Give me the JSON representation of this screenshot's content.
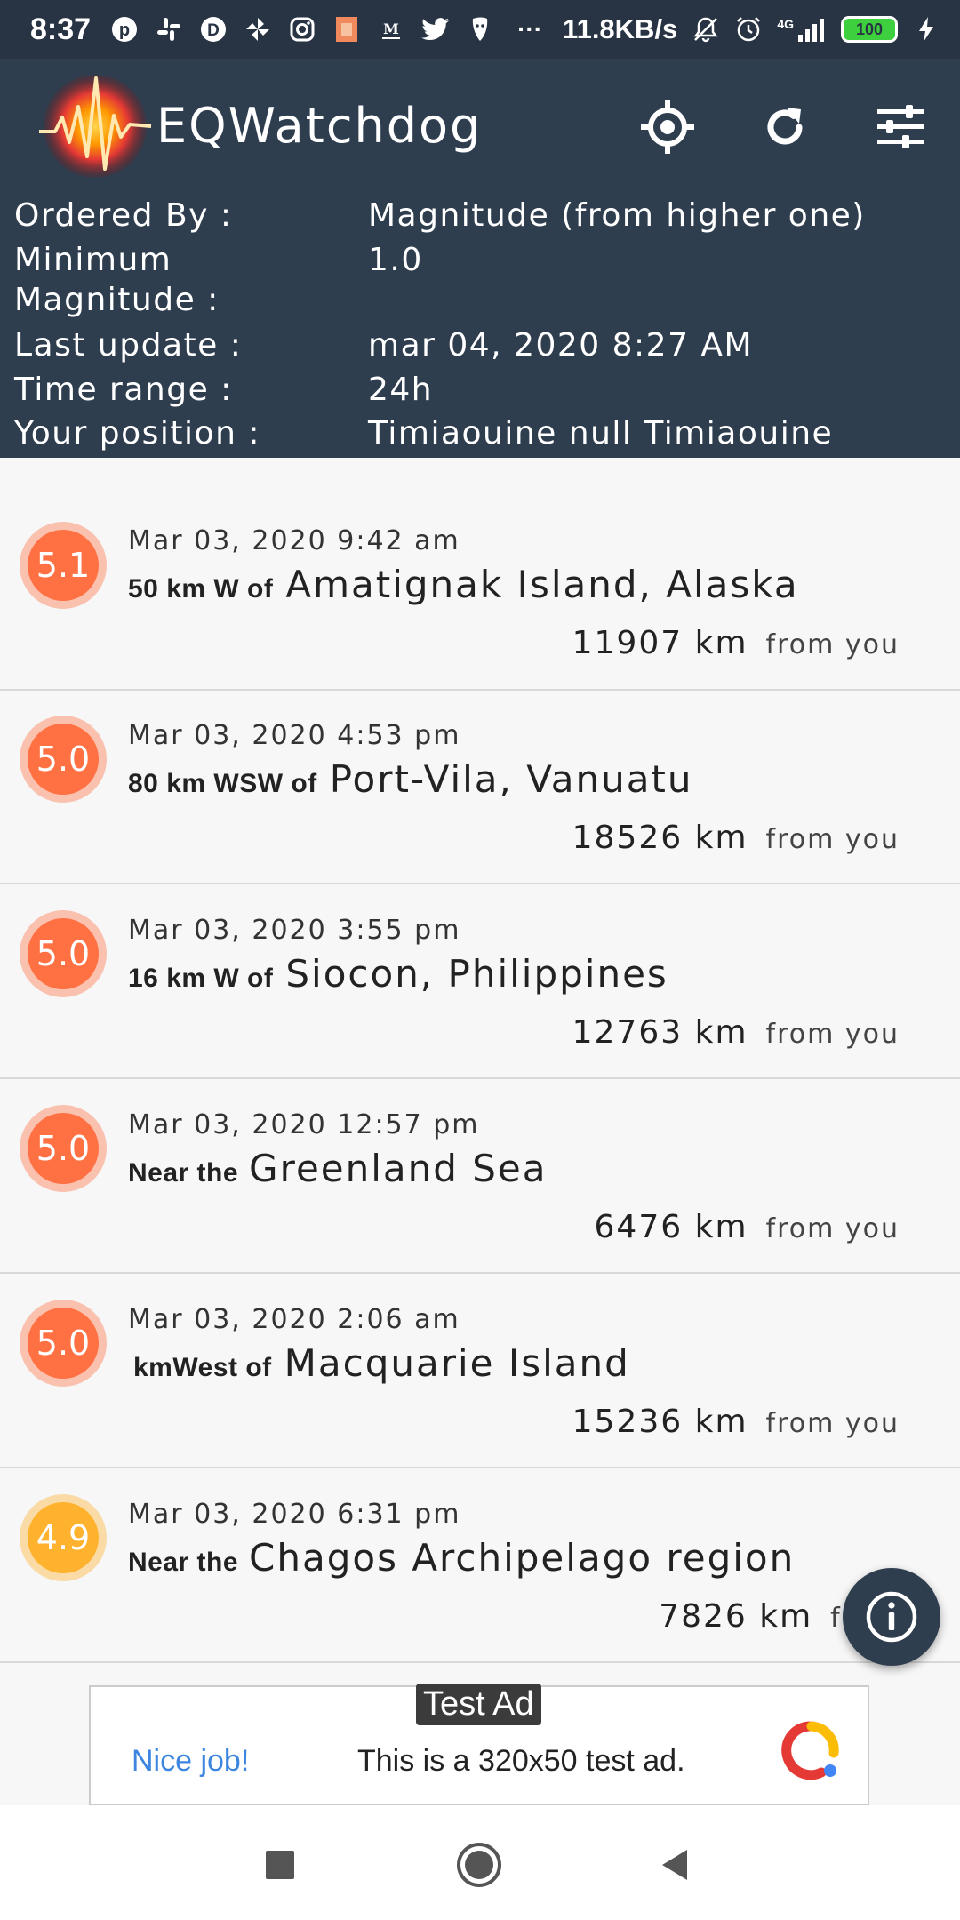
{
  "status_bar": {
    "time": "8:37",
    "more": "···",
    "net_speed": "11.8KB/s",
    "network": "4G",
    "battery": "100"
  },
  "app": {
    "title": "EQWatchdog",
    "colors": {
      "bar": "#2f3e4f",
      "status": "#283443"
    }
  },
  "info": [
    {
      "label": "Ordered By :",
      "value": "Magnitude (from higher one)"
    },
    {
      "label": "Minimum Magnitude :",
      "value": "1.0"
    },
    {
      "label": "Last update :",
      "value": "mar 04, 2020 8:27 AM"
    },
    {
      "label": "Time range :",
      "value": "24h"
    },
    {
      "label": "Your position :",
      "value": "Timiaouine null Timiaouine"
    }
  ],
  "quakes": [
    {
      "mag": "5.1",
      "date": "Mar 03, 2020 9:42 am",
      "prefix": "50 km W of",
      "location": "Amatignak Island, Alaska",
      "distance": "11907 km",
      "from": "from you",
      "color": "#ff7043"
    },
    {
      "mag": "5.0",
      "date": "Mar 03, 2020 4:53 pm",
      "prefix": "80 km WSW of",
      "location": "Port-Vila, Vanuatu",
      "distance": "18526 km",
      "from": "from you",
      "color": "#ff7043"
    },
    {
      "mag": "5.0",
      "date": "Mar 03, 2020 3:55 pm",
      "prefix": "16 km W of",
      "location": "Siocon, Philippines",
      "distance": "12763 km",
      "from": "from you",
      "color": "#ff7043"
    },
    {
      "mag": "5.0",
      "date": "Mar 03, 2020 12:57 pm",
      "prefix": "Near the",
      "location": "Greenland Sea",
      "distance": "6476 km",
      "from": "from you",
      "color": "#ff7043"
    },
    {
      "mag": "5.0",
      "date": "Mar 03, 2020 2:06 am",
      "prefix": "kmWest of",
      "location": "Macquarie Island",
      "distance": "15236 km",
      "from": "from you",
      "color": "#ff7043"
    },
    {
      "mag": "4.9",
      "date": "Mar 03, 2020 6:31 pm",
      "prefix": "Near the",
      "location": "Chagos Archipelago region",
      "distance": "7826 km",
      "from": "from",
      "color": "#ffb22e"
    }
  ],
  "ad": {
    "tag": "Test Ad",
    "nice": "Nice job!",
    "text": "This is a 320x50 test ad."
  }
}
